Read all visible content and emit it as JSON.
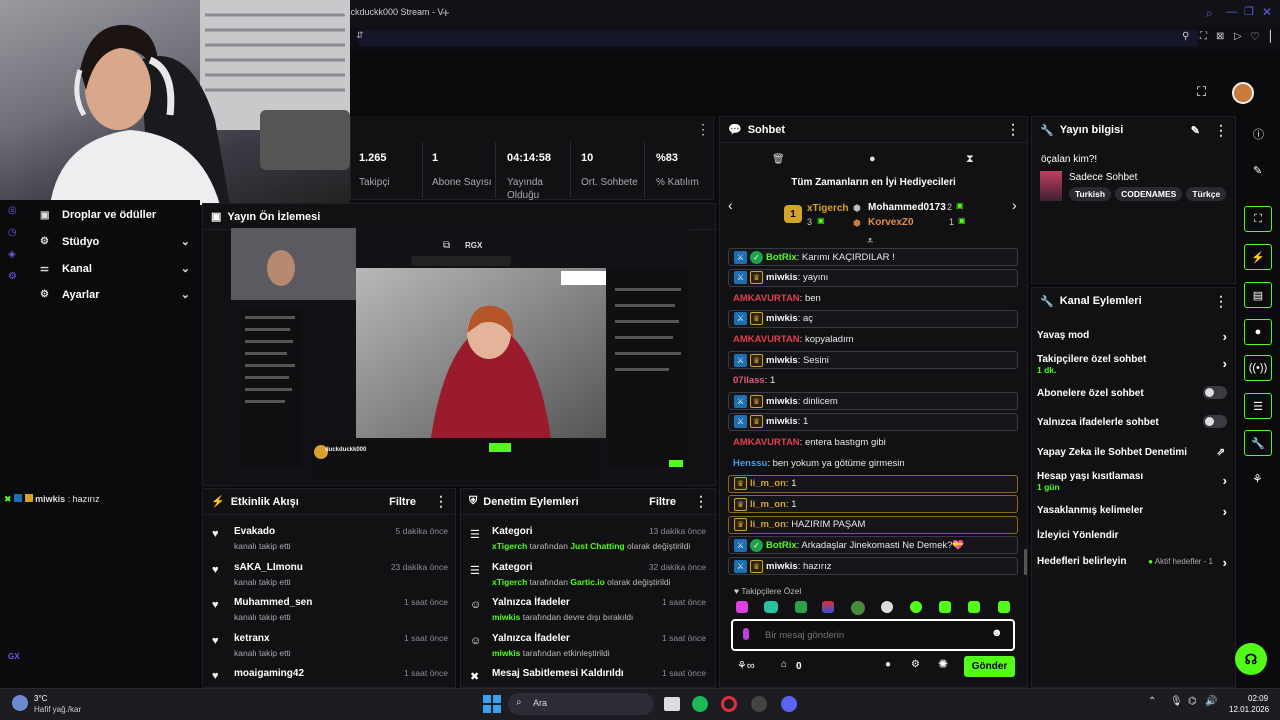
{
  "browser": {
    "tab_title": "kickduckk000 Stream - V"
  },
  "stats": [
    {
      "value": "1.265",
      "label": "Takipçi"
    },
    {
      "value": "1",
      "label": "Abone Sayısı"
    },
    {
      "value": "04:14:58",
      "label": "Yayında Olduğu"
    },
    {
      "value": "10",
      "label": "Ort. Sohbete"
    },
    {
      "value": "%83",
      "label": "% Katılım"
    }
  ],
  "sidebar": {
    "items": [
      {
        "label": "Droplar ve ödüller",
        "icon": "gift-icon"
      },
      {
        "label": "Stüdyo",
        "icon": "gear-icon"
      },
      {
        "label": "Kanal",
        "icon": "sliders-icon"
      },
      {
        "label": "Ayarlar",
        "icon": "cog-icon"
      }
    ],
    "mini_chat": {
      "user": "miwkis",
      "text": "hazırız"
    },
    "footer_label": "GX"
  },
  "preview": {
    "title": "Yayın Ön İzlemesi",
    "streamer": "duckduckk000",
    "chip": "RGX"
  },
  "chat": {
    "title": "Sohbet",
    "gifters_title": "Tüm Zamanların en İyi Hediyecileri",
    "gifters": [
      {
        "rank": "1",
        "name": "xTigerch",
        "count": "3"
      },
      {
        "rank": "2",
        "name": "Mohammed0173",
        "count": "2"
      },
      {
        "rank": "3",
        "name": "KorvexZ0",
        "count": "1"
      }
    ],
    "messages": [
      {
        "user": "BotRix",
        "text": "Karımı KAÇIRDILAR !",
        "color": "#53fc18",
        "style": "boxed",
        "badges": [
          "blue",
          "green"
        ]
      },
      {
        "user": "miwkis",
        "text": "yayını",
        "color": "#f5f5f5",
        "style": "boxed",
        "badges": [
          "blue",
          "gold"
        ]
      },
      {
        "user": "AMKAVURTAN",
        "text": "ben",
        "color": "#e0404a",
        "style": "plain",
        "badges": []
      },
      {
        "user": "miwkis",
        "text": "aç",
        "color": "#f5f5f5",
        "style": "boxed",
        "badges": [
          "blue",
          "gold"
        ]
      },
      {
        "user": "AMKAVURTAN",
        "text": "kopyaladım",
        "color": "#e0404a",
        "style": "plain",
        "badges": []
      },
      {
        "user": "miwkis",
        "text": "Sesini",
        "color": "#f5f5f5",
        "style": "boxed",
        "badges": [
          "blue",
          "gold"
        ]
      },
      {
        "user": "07llass",
        "text": "1",
        "color": "#e05a7a",
        "style": "plain",
        "badges": []
      },
      {
        "user": "miwkis",
        "text": "dinlicem",
        "color": "#f5f5f5",
        "style": "boxed",
        "badges": [
          "blue",
          "gold"
        ]
      },
      {
        "user": "miwkis",
        "text": "1",
        "color": "#f5f5f5",
        "style": "boxed",
        "badges": [
          "blue",
          "gold"
        ]
      },
      {
        "user": "AMKAVURTAN",
        "text": "entera bastıgm gibi",
        "color": "#e0404a",
        "style": "plain",
        "badges": []
      },
      {
        "user": "Henssu",
        "text": "ben yokum ya götüme girmesin",
        "color": "#4a9de0",
        "style": "plain",
        "badges": []
      },
      {
        "user": "li_m_on",
        "text": "1",
        "color": "#d4a32a",
        "style": "gold",
        "badges": [
          "gold"
        ]
      },
      {
        "user": "li_m_on",
        "text": "1",
        "color": "#d4a32a",
        "style": "gold",
        "badges": [
          "gold"
        ]
      },
      {
        "user": "li_m_on",
        "text": "HAZIRIM PAŞAM",
        "color": "#d4a32a",
        "style": "gold",
        "badges": [
          "gold"
        ]
      },
      {
        "user": "BotRix",
        "text": "Arkadaşlar Jinekomasti Ne Demek?💝",
        "color": "#53fc18",
        "style": "boxed",
        "badges": [
          "blue",
          "green"
        ]
      },
      {
        "user": "miwkis",
        "text": "hazırız",
        "color": "#f5f5f5",
        "style": "boxed",
        "badges": [
          "blue",
          "gold"
        ]
      }
    ],
    "emote_label": "Takipçilere Özel",
    "input_placeholder": "Bir mesaj gönderin",
    "points": "0",
    "send_label": "Gönder"
  },
  "stream_info": {
    "title": "Yayın bilgisi",
    "stream_title": "öçalan kim?!",
    "category": "Sadece Sohbet",
    "tags": [
      "Turkish",
      "CODENAMES",
      "Türkçe"
    ]
  },
  "channel_actions": {
    "title": "Kanal Eylemleri",
    "items": [
      {
        "label": "Yavaş mod",
        "sub": "",
        "control": "chevron"
      },
      {
        "label": "Takipçilere özel sohbet",
        "sub": "1 dk.",
        "control": "chevron"
      },
      {
        "label": "Abonelere özel sohbet",
        "sub": "",
        "control": "toggle"
      },
      {
        "label": "Yalnızca ifadelerle sohbet",
        "sub": "",
        "control": "toggle"
      },
      {
        "label": "Yapay Zeka ile Sohbet Denetimi",
        "sub": "",
        "control": "external"
      },
      {
        "label": "Hesap yaşı kısıtlaması",
        "sub": "1 gün",
        "control": "chevron"
      },
      {
        "label": "Yasaklanmış kelimeler",
        "sub": "",
        "control": "chevron"
      },
      {
        "label": "İzleyici Yönlendir",
        "sub": "",
        "control": "none"
      },
      {
        "label": "Hedefleri belirleyin",
        "sub": "",
        "control": "chevron",
        "extra": "Aktif hedefler - 1"
      }
    ]
  },
  "activity": {
    "title": "Etkinlik Akışı",
    "filter": "Filtre",
    "items": [
      {
        "name": "Evakado",
        "sub": "kanalı takip etti",
        "time": "5 dakika önce"
      },
      {
        "name": "sAKA_LImonu",
        "sub": "kanalı takip etti",
        "time": "23 dakika önce"
      },
      {
        "name": "Muhammed_sen",
        "sub": "kanalı takip etti",
        "time": "1 saat önce"
      },
      {
        "name": "ketranx",
        "sub": "kanalı takip etti",
        "time": "1 saat önce"
      },
      {
        "name": "moaigaming42",
        "sub": "",
        "time": "1 saat önce"
      }
    ]
  },
  "moderation": {
    "title": "Denetim Eylemleri",
    "filter": "Filtre",
    "items": [
      {
        "name": "Kategori",
        "actor": "xTigerch",
        "mid": "tarafından",
        "val": "Just Chatting",
        "end": "olarak değiştirildi",
        "time": "13 dakika önce"
      },
      {
        "name": "Kategori",
        "actor": "xTigerch",
        "mid": "tarafından",
        "val": "Gartic.io",
        "end": "olarak değiştirildi",
        "time": "32 dakika önce"
      },
      {
        "name": "Yalnızca İfadeler",
        "actor": "miwkis",
        "mid": "tarafından devre dışı bırakıldı",
        "val": "",
        "end": "",
        "time": "1 saat önce"
      },
      {
        "name": "Yalnızca İfadeler",
        "actor": "miwkis",
        "mid": "tarafından etkinleştirildi",
        "val": "",
        "end": "",
        "time": "1 saat önce"
      },
      {
        "name": "Mesaj Sabitlemesi Kaldırıldı",
        "actor": "",
        "mid": "",
        "val": "",
        "end": "",
        "time": "1 saat önce"
      }
    ]
  },
  "taskbar": {
    "weather_temp": "3°C",
    "weather_desc": "Hafif yağ./kar",
    "search": "Ara",
    "time": "02:09",
    "date": "12.01.2026"
  },
  "colors": {
    "accent": "#53fc18",
    "background": "#0b0b0d",
    "panel": "#111114"
  }
}
